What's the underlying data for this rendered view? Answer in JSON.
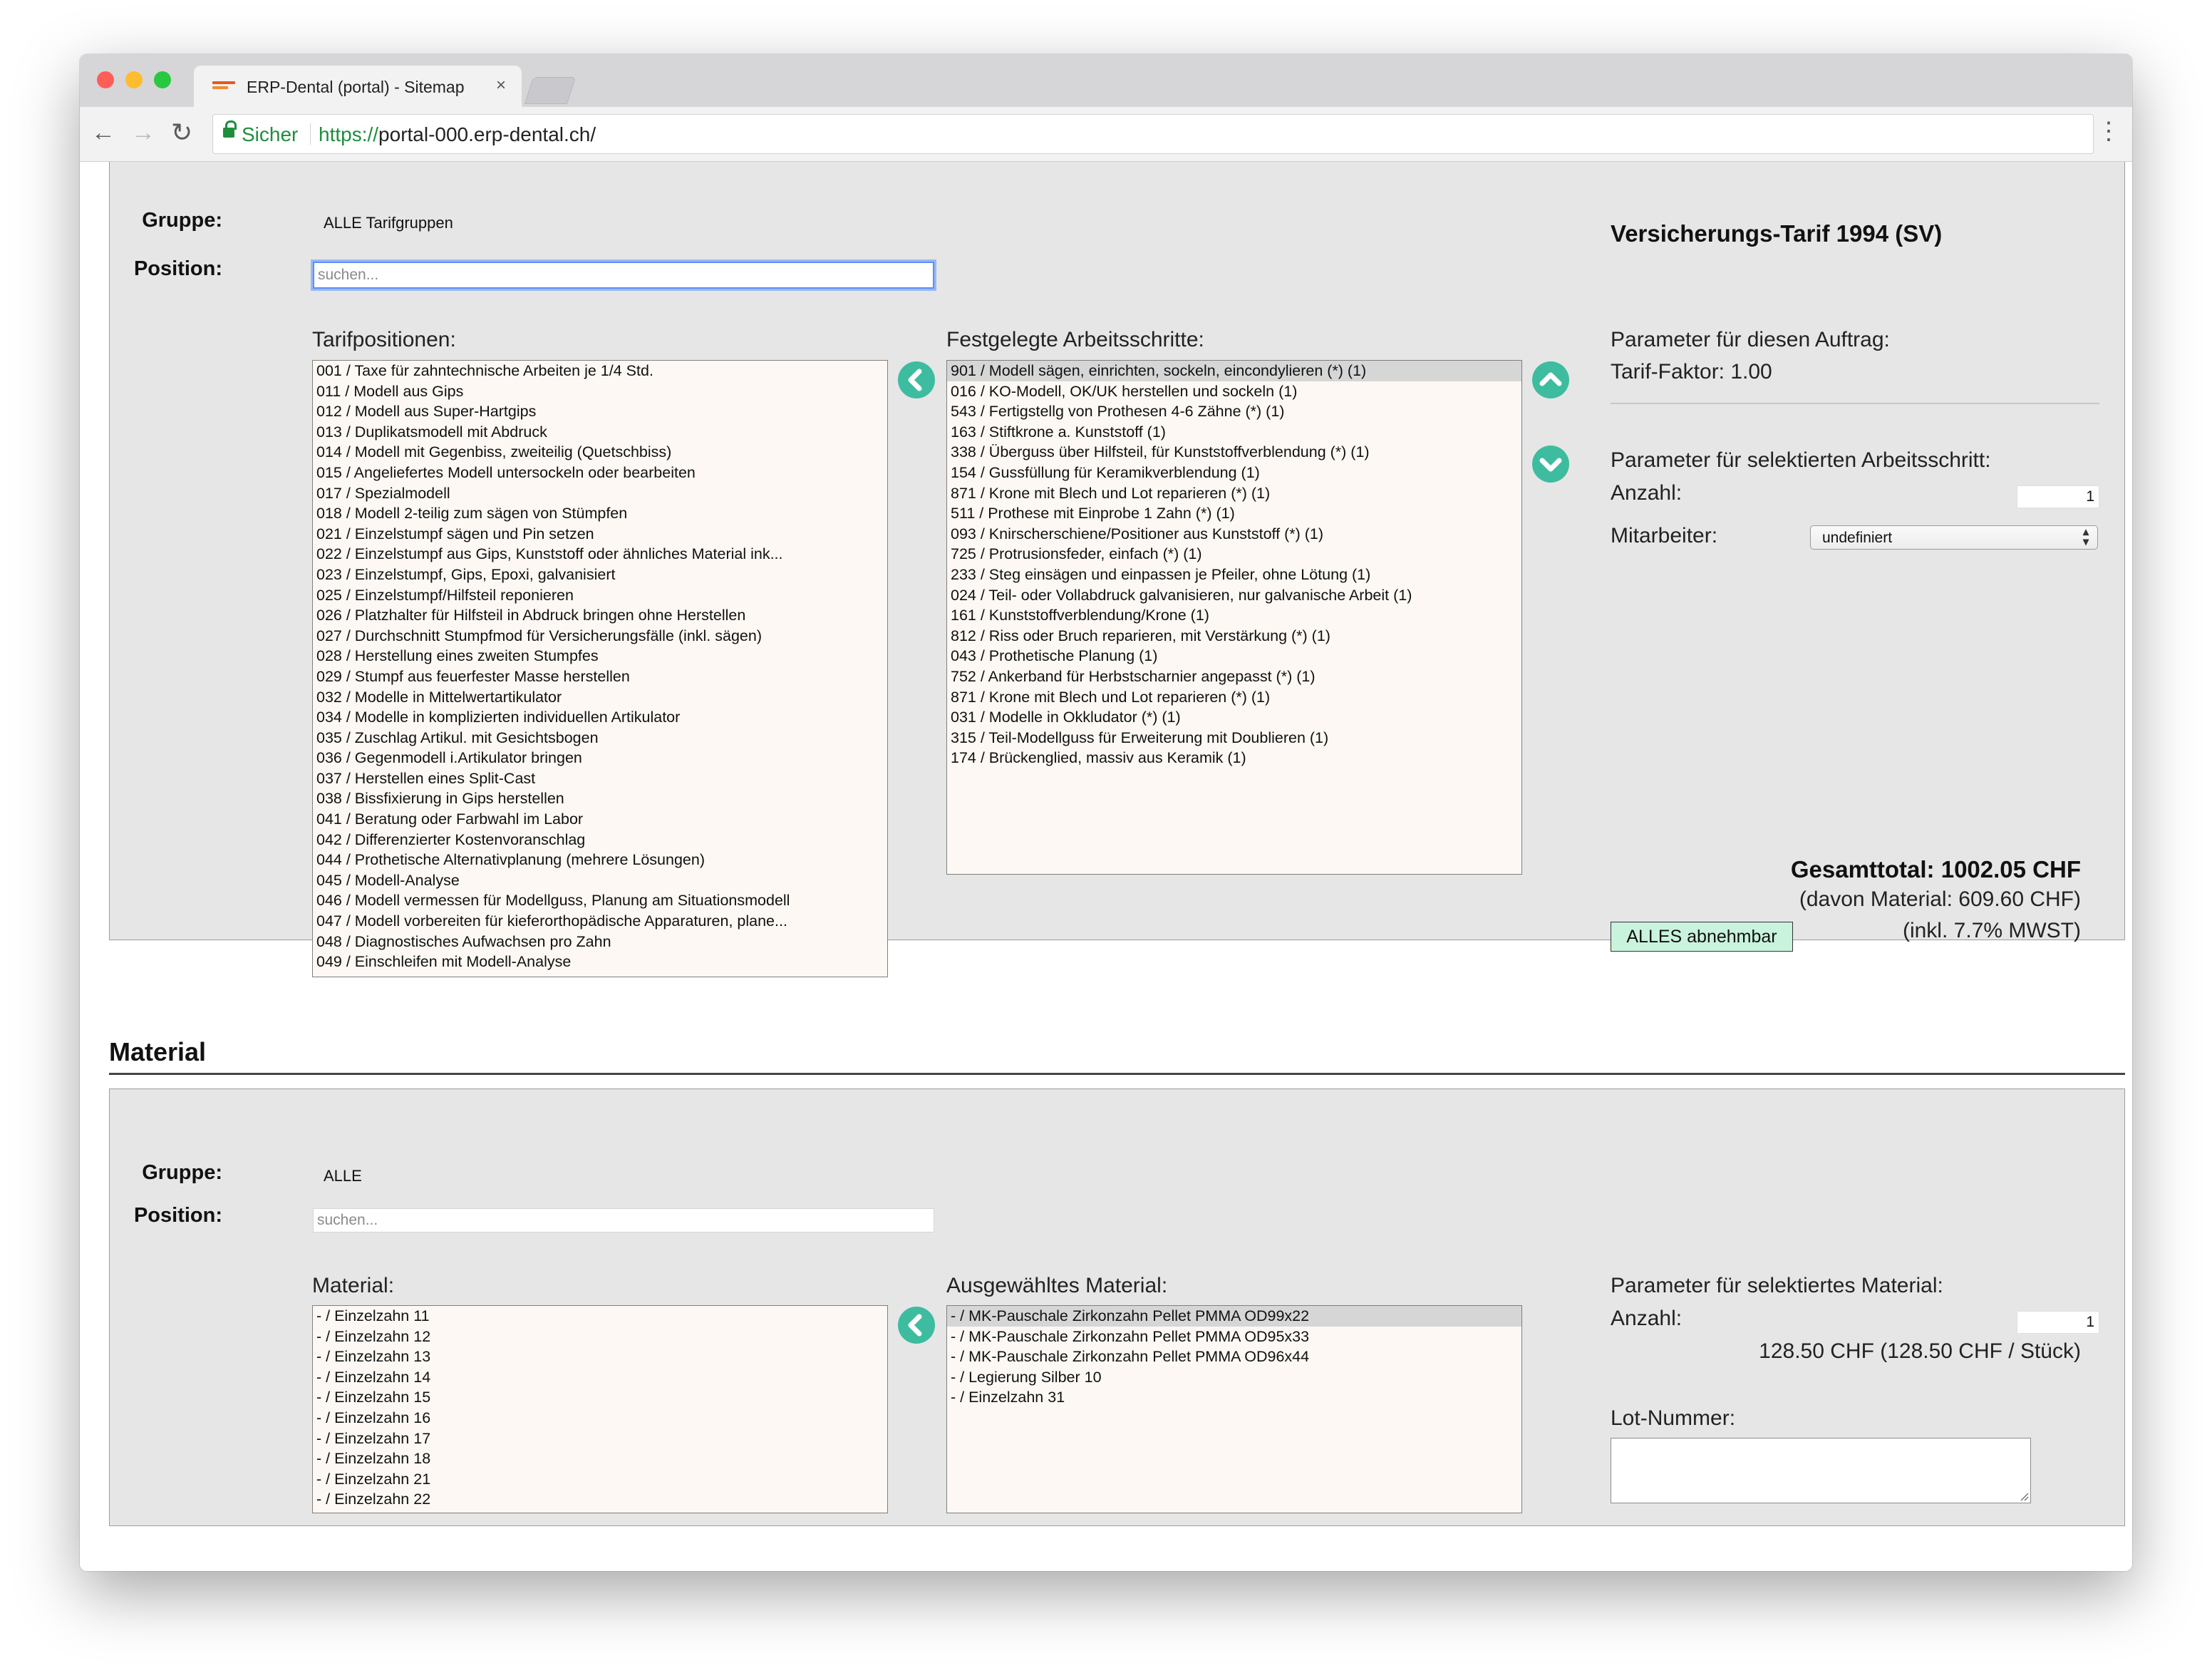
{
  "browser": {
    "tab_title": "ERP-Dental (portal) - Sitemap",
    "tab_close": "×",
    "secure_label": "Sicher",
    "url_scheme": "https://",
    "url_rest": "portal-000.erp-dental.ch/"
  },
  "icons": {
    "back": "←",
    "forward": "→",
    "reload": "↻",
    "menu": "⋮"
  },
  "tarif": {
    "gruppe_label": "Gruppe:",
    "gruppe_value": "ALLE Tarifgruppen",
    "position_label": "Position:",
    "search_placeholder": "suchen...",
    "tarif_title": "Versicherungs-Tarif 1994 (SV)",
    "tarifpositionen_header": "Tarifpositionen:",
    "festgelegte_header": "Festgelegte Arbeitsschritte:",
    "tarifpositionen": [
      "001 / Taxe für zahntechnische Arbeiten je 1/4 Std.",
      "011 / Modell aus Gips",
      "012 / Modell aus Super-Hartgips",
      "013 / Duplikatsmodell mit Abdruck",
      "014 / Modell mit Gegenbiss, zweiteilig (Quetschbiss)",
      "015 / Angeliefertes Modell untersockeln oder bearbeiten",
      "017 / Spezialmodell",
      "018 / Modell 2-teilig zum sägen von Stümpfen",
      "021 / Einzelstumpf sägen und Pin setzen",
      "022 / Einzelstumpf aus Gips, Kunststoff oder ähnliches Material ink...",
      "023 / Einzelstumpf, Gips, Epoxi, galvanisiert",
      "025 / Einzelstumpf/Hilfsteil reponieren",
      "026 / Platzhalter für Hilfsteil in Abdruck bringen ohne Herstellen",
      "027 / Durchschnitt Stumpfmod für Versicherungsfälle (inkl. sägen)",
      "028 / Herstellung eines zweiten Stumpfes",
      "029 / Stumpf aus feuerfester Masse herstellen",
      "032 / Modelle in Mittelwertartikulator",
      "034 / Modelle in komplizierten individuellen Artikulator",
      "035 / Zuschlag Artikul. mit Gesichtsbogen",
      "036 / Gegenmodell i.Artikulator bringen",
      "037 / Herstellen eines Split-Cast",
      "038 / Bissfixierung in Gips herstellen",
      "041 / Beratung oder Farbwahl im Labor",
      "042 / Differenzierter Kostenvoranschlag",
      "044 / Prothetische Alternativplanung (mehrere Lösungen)",
      "045 / Modell-Analyse",
      "046 / Modell vermessen für Modellguss, Planung am Situationsmodell",
      "047 / Modell vorbereiten für kieferorthopädische Apparaturen, plane...",
      "048 / Diagnostisches Aufwachsen pro Zahn",
      "049 / Einschleifen mit Modell-Analyse"
    ],
    "festgelegte": [
      "901 / Modell sägen, einrichten, sockeln, eincondylieren (*) (1)",
      "016 / KO-Modell, OK/UK herstellen und sockeln (1)",
      "543 / Fertigstellg von Prothesen 4-6 Zähne (*) (1)",
      "163 / Stiftkrone a. Kunststoff (1)",
      "338 / Überguss über Hilfsteil, für Kunststoffverblendung (*) (1)",
      "154 / Gussfüllung für Keramikverblendung (1)",
      "871 / Krone mit Blech und Lot reparieren (*) (1)",
      "511 / Prothese mit Einprobe 1 Zahn (*) (1)",
      "093 / Knirscherschiene/Positioner aus Kunststoff (*) (1)",
      "725 / Protrusionsfeder, einfach (*) (1)",
      "233 / Steg einsägen und einpassen je Pfeiler, ohne Lötung (1)",
      "024 / Teil- oder Vollabdruck galvanisieren, nur galvanische Arbeit (1)",
      "161 / Kunststoffverblendung/Krone (1)",
      "812 / Riss oder Bruch reparieren, mit Verstärkung (*) (1)",
      "043 / Prothetische Planung (1)",
      "752 / Ankerband für Herbstscharnier angepasst (*) (1)",
      "871 / Krone mit Blech und Lot reparieren (*) (1)",
      "031 / Modelle in Okkludator (*) (1)",
      "315 / Teil-Modellguss für Erweiterung mit Doublieren (1)",
      "174 / Brückenglied, massiv aus Keramik (1)"
    ],
    "params_auftrag_label": "Parameter für diesen Auftrag:",
    "tarif_faktor": "Tarif-Faktor: 1.00",
    "params_selektiert_label": "Parameter für selektierten Arbeitsschritt:",
    "anzahl_label": "Anzahl:",
    "anzahl_value": "1",
    "mitarbeiter_label": "Mitarbeiter:",
    "mitarbeiter_value": "undefiniert",
    "gesamttotal": "Gesamttotal: 1002.05 CHF",
    "davon_material": "(davon Material: 609.60 CHF)",
    "inkl_mwst": "(inkl. 7.7% MWST)",
    "alles_button": "ALLES abnehmbar"
  },
  "material": {
    "section_title": "Material",
    "gruppe_label": "Gruppe:",
    "gruppe_value": "ALLE",
    "position_label": "Position:",
    "search_placeholder": "suchen...",
    "material_header": "Material:",
    "ausgewaehlt_header": "Ausgewähltes Material:",
    "material_list": [
      "- / Einzelzahn 11",
      "- / Einzelzahn 12",
      "- / Einzelzahn 13",
      "- / Einzelzahn 14",
      "- / Einzelzahn 15",
      "- / Einzelzahn 16",
      "- / Einzelzahn 17",
      "- / Einzelzahn 18",
      "- / Einzelzahn 21",
      "- / Einzelzahn 22"
    ],
    "ausgewaehlt_list": [
      "- / MK-Pauschale Zirkonzahn Pellet PMMA OD99x22",
      "- / MK-Pauschale Zirkonzahn Pellet PMMA OD95x33",
      "- / MK-Pauschale Zirkonzahn Pellet PMMA OD96x44",
      "- / Legierung Silber 10",
      "- / Einzelzahn 31"
    ],
    "params_label": "Parameter für selektiertes Material:",
    "anzahl_label": "Anzahl:",
    "anzahl_value": "1",
    "price": "128.50 CHF (128.50 CHF / Stück)",
    "lot_label": "Lot-Nummer:"
  }
}
